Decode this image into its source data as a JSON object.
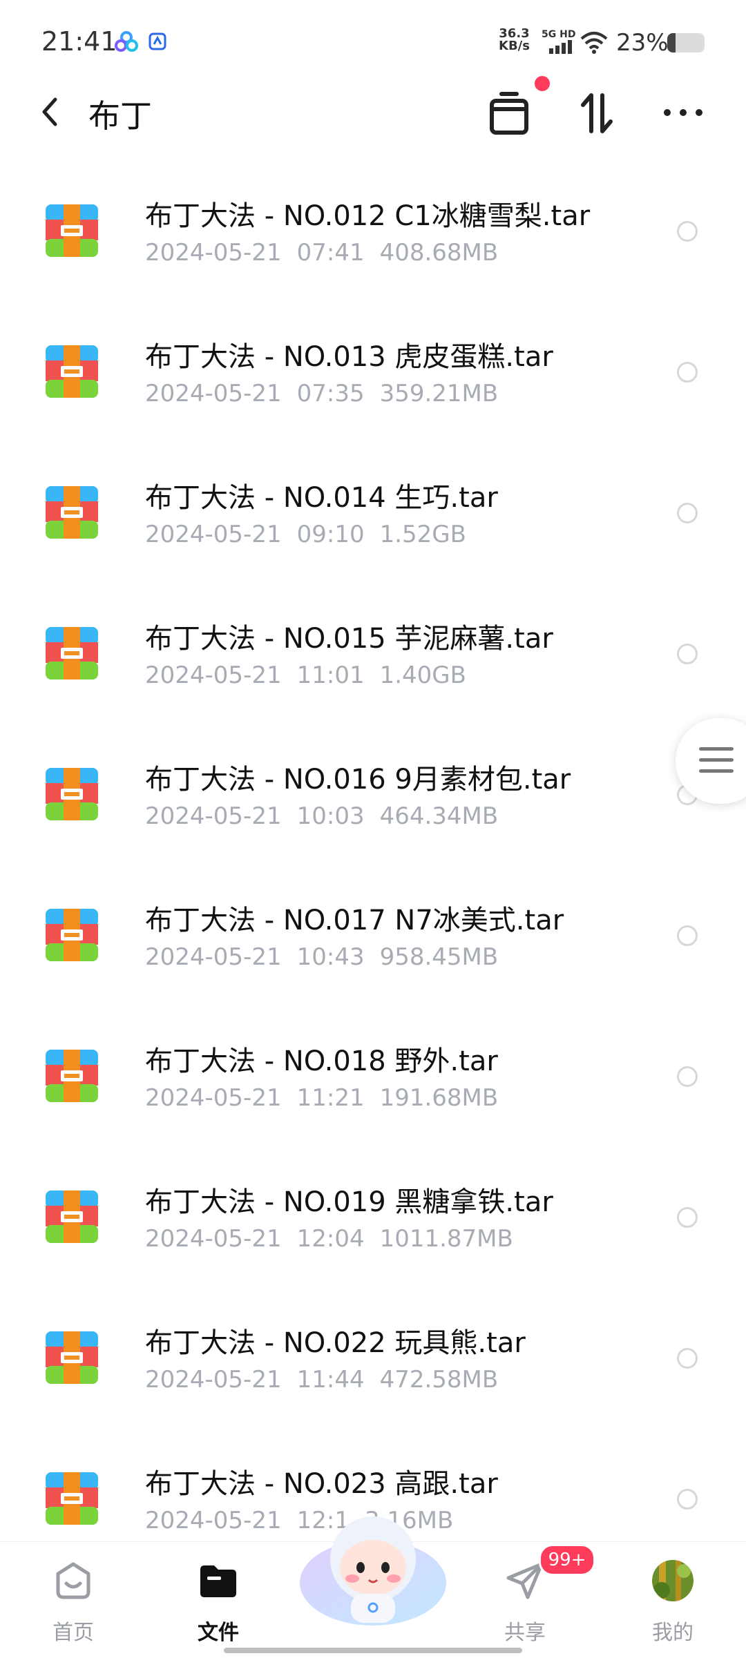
{
  "status_bar": {
    "time": "21:41",
    "speed_value": "36.3",
    "speed_unit": "KB/s",
    "network": "5G HD",
    "battery_percent": "23%",
    "battery_level": 0.23
  },
  "header": {
    "title": "布丁",
    "back_icon": "chevron-left-icon",
    "archive_icon": "archive-box-icon",
    "sort_icon": "sort-arrows-icon",
    "more_icon": "more-dots-icon",
    "accent_dot_color": "#ff3b5c"
  },
  "files": [
    {
      "name": "布丁大法 - NO.012 C1冰糖雪梨.tar",
      "date": "2024-05-21",
      "time": "07:41",
      "size": "408.68MB"
    },
    {
      "name": "布丁大法 - NO.013 虎皮蛋糕.tar",
      "date": "2024-05-21",
      "time": "07:35",
      "size": "359.21MB"
    },
    {
      "name": "布丁大法 - NO.014 生巧.tar",
      "date": "2024-05-21",
      "time": "09:10",
      "size": "1.52GB"
    },
    {
      "name": "布丁大法 - NO.015 芋泥麻薯.tar",
      "date": "2024-05-21",
      "time": "11:01",
      "size": "1.40GB"
    },
    {
      "name": "布丁大法 - NO.016 9月素材包.tar",
      "date": "2024-05-21",
      "time": "10:03",
      "size": "464.34MB"
    },
    {
      "name": "布丁大法 - NO.017 N7冰美式.tar",
      "date": "2024-05-21",
      "time": "10:43",
      "size": "958.45MB"
    },
    {
      "name": "布丁大法 - NO.018 野外.tar",
      "date": "2024-05-21",
      "time": "11:21",
      "size": "191.68MB"
    },
    {
      "name": "布丁大法 - NO.019 黑糖拿铁.tar",
      "date": "2024-05-21",
      "time": "12:04",
      "size": "1011.87MB"
    },
    {
      "name": "布丁大法 - NO.022 玩具熊.tar",
      "date": "2024-05-21",
      "time": "11:44",
      "size": "472.58MB"
    },
    {
      "name": "布丁大法 - NO.023 高跟.tar",
      "date": "2024-05-21",
      "time": "12:1",
      "size": "3.16MB"
    }
  ],
  "bottom_nav": {
    "items": [
      {
        "label": "首页",
        "icon": "home-icon"
      },
      {
        "label": "文件",
        "icon": "folder-icon"
      },
      {
        "label": "共享",
        "icon": "share-plane-icon"
      },
      {
        "label": "我的",
        "icon": "avatar"
      }
    ],
    "badge": "99+",
    "active_index": 1
  }
}
